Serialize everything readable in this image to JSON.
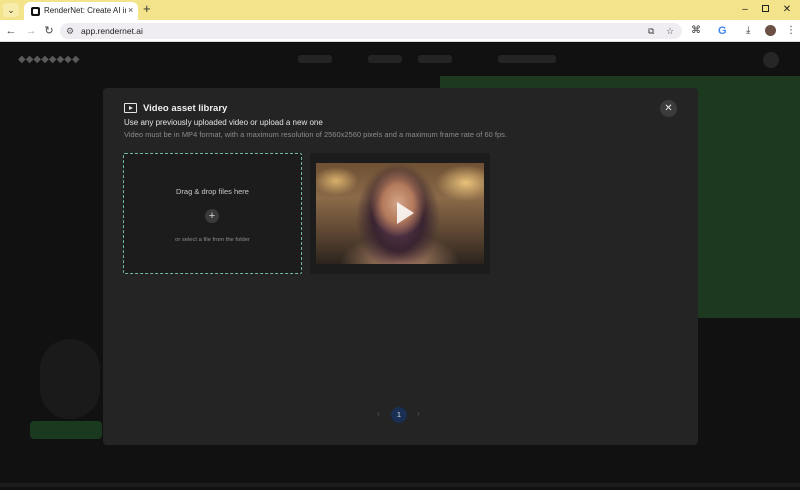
{
  "browser": {
    "tab_title": "RenderNet: Create AI images w",
    "tab_close": "×",
    "new_tab": "+",
    "url": "app.rendernet.ai",
    "window_controls": {
      "minimize": "–",
      "close": "✕"
    },
    "icons": {
      "back": "←",
      "forward": "→",
      "reload": "↻",
      "site_info": "⚙",
      "install": "⧉",
      "star": "☆",
      "extensions": "⌘",
      "google": "G",
      "download": "⤓",
      "more": "⋮"
    }
  },
  "modal": {
    "title": "Video asset library",
    "subtitle": "Use any previously uploaded video or upload a new one",
    "note": "Video must be in MP4 format, with a maximum resolution of 2560x2560 pixels and a maximum frame rate of 60 fps.",
    "close_icon": "✕",
    "dropzone": {
      "title": "Drag & drop files here",
      "plus": "+",
      "subtitle": "or select a file from the folder"
    },
    "pagination": {
      "prev": "‹",
      "current": "1",
      "next": "›"
    }
  },
  "colors": {
    "modal_bg": "#242424",
    "dropzone_border": "#6fb89b",
    "page_accent_green": "#1d3a21",
    "pagination_active": "#1a2f52"
  }
}
